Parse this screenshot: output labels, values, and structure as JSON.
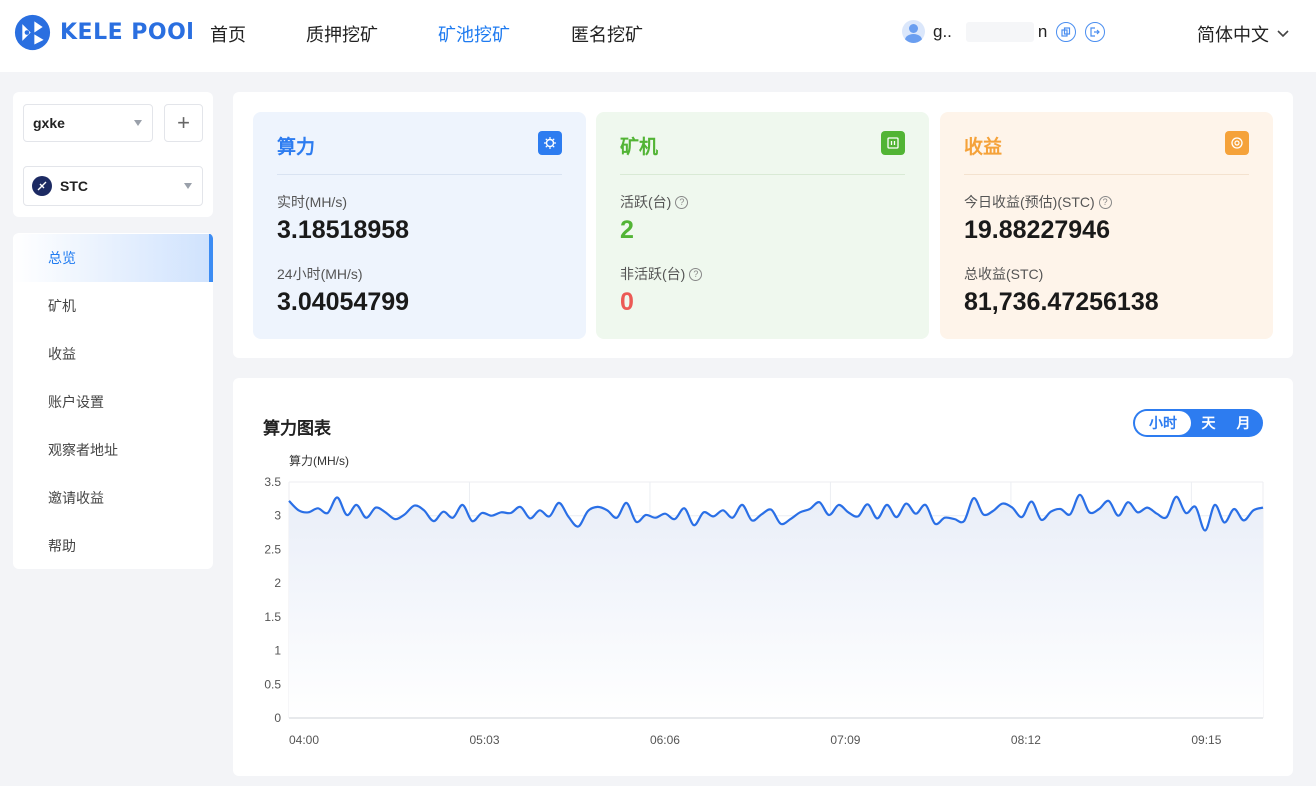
{
  "header": {
    "logo_text": "KELE POOl",
    "nav": [
      {
        "label": "首页",
        "active": false
      },
      {
        "label": "质押挖矿",
        "active": false
      },
      {
        "label": "矿池挖矿",
        "active": true
      },
      {
        "label": "匿名挖矿",
        "active": false
      }
    ],
    "user": {
      "name_left": "g..",
      "name_right": "n"
    },
    "language": "简体中文"
  },
  "sidebar": {
    "account_select": "gxke",
    "add_label": "+",
    "coin_select": "STC",
    "menu": [
      {
        "label": "总览",
        "active": true
      },
      {
        "label": "矿机",
        "active": false
      },
      {
        "label": "收益",
        "active": false
      },
      {
        "label": "账户设置",
        "active": false
      },
      {
        "label": "观察者地址",
        "active": false
      },
      {
        "label": "邀请收益",
        "active": false
      },
      {
        "label": "帮助",
        "active": false
      }
    ]
  },
  "stats": {
    "hashrate": {
      "title": "算力",
      "realtime_label": "实时(MH/s)",
      "realtime_value": "3.18518958",
      "day_label": "24小时(MH/s)",
      "day_value": "3.04054799"
    },
    "miners": {
      "title": "矿机",
      "active_label": "活跃(台)",
      "active_value": "2",
      "inactive_label": "非活跃(台)",
      "inactive_value": "0"
    },
    "income": {
      "title": "收益",
      "today_label": "今日收益(预估)(STC)",
      "today_value": "19.88227946",
      "total_label": "总收益(STC)",
      "total_value": "81,736.47256138"
    },
    "help_mark": "?"
  },
  "chart_panel": {
    "title": "算力图表",
    "toggle": [
      {
        "label": "小时",
        "active": true
      },
      {
        "label": "天",
        "active": false
      },
      {
        "label": "月",
        "active": false
      }
    ]
  },
  "colors": {
    "primary": "#2d7cf0",
    "green": "#52b435",
    "orange": "#f5a23a",
    "red": "#ec5a55",
    "line": "#2a6fe6"
  },
  "chart_data": {
    "type": "area",
    "title": "",
    "ylabel": "算力(MH/s)",
    "xlabel": "",
    "ylim": [
      0,
      3.5
    ],
    "yticks": [
      "0",
      "0.5",
      "1",
      "1.5",
      "2",
      "2.5",
      "3",
      "3.5"
    ],
    "xticks": [
      "04:00",
      "05:03",
      "06:06",
      "07:09",
      "08:12",
      "09:15"
    ],
    "x_start": "04:00",
    "x_end": "09:40",
    "series": [
      {
        "values": [
          3.22,
          3.08,
          3.05,
          3.11,
          3.04,
          3.27,
          3.01,
          3.16,
          2.97,
          3.12,
          3.05,
          2.95,
          3.02,
          3.15,
          3.08,
          2.92,
          3.06,
          2.97,
          3.16,
          2.92,
          3.04,
          3.0,
          3.05,
          3.04,
          3.13,
          2.96,
          3.08,
          2.99,
          3.19,
          2.98,
          2.84,
          3.07,
          3.13,
          3.08,
          2.97,
          3.19,
          2.91,
          3.01,
          2.97,
          3.03,
          2.95,
          3.11,
          2.86,
          3.05,
          2.99,
          3.08,
          2.97,
          3.16,
          2.93,
          3.02,
          3.09,
          2.88,
          2.95,
          3.05,
          3.1,
          3.2,
          3.01,
          3.16,
          3.05,
          2.99,
          3.17,
          2.96,
          3.16,
          2.98,
          3.18,
          3.03,
          3.16,
          2.88,
          2.97,
          2.95,
          2.92,
          3.26,
          3.02,
          3.07,
          3.18,
          3.12,
          2.98,
          3.21,
          2.94,
          3.06,
          3.1,
          3.02,
          3.31,
          3.05,
          3.1,
          3.22,
          3.0,
          3.2,
          3.05,
          3.12,
          3.03,
          2.98,
          3.28,
          3.04,
          3.13,
          2.78,
          3.16,
          2.9,
          3.1,
          2.93,
          3.08,
          3.12
        ]
      }
    ],
    "grid": true,
    "legend": "none"
  }
}
